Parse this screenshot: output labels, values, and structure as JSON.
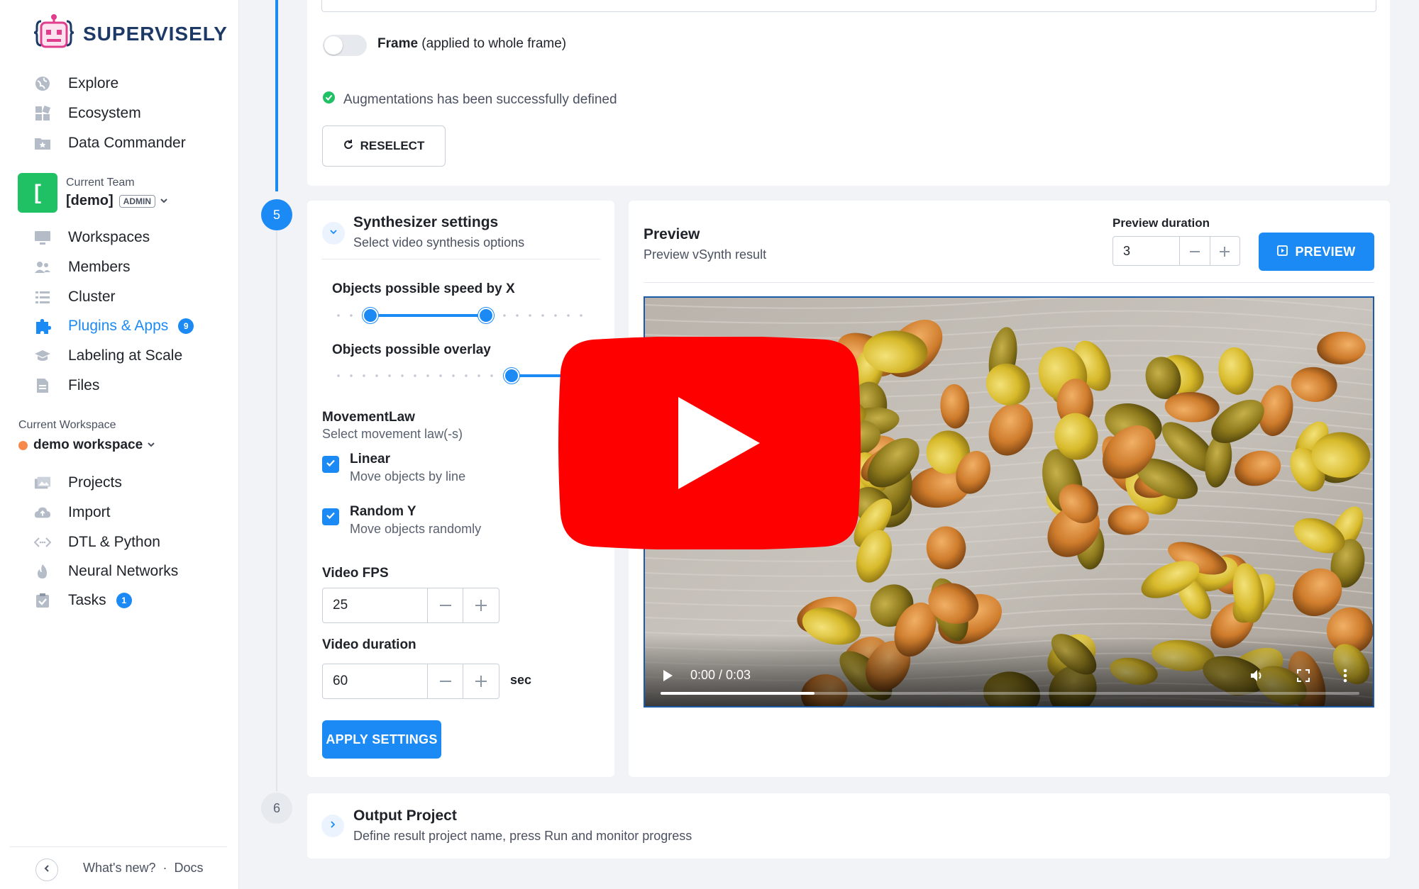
{
  "brand": {
    "name": "SUPERVISELY"
  },
  "sidebar": {
    "top_items": [
      {
        "label": "Explore",
        "icon": "globe-icon"
      },
      {
        "label": "Ecosystem",
        "icon": "grid-icon"
      },
      {
        "label": "Data Commander",
        "icon": "star-folder-icon"
      }
    ],
    "team": {
      "caption": "Current Team",
      "initial": "[",
      "name": "[demo]",
      "role": "ADMIN"
    },
    "team_items": [
      {
        "label": "Workspaces",
        "icon": "monitor-icon"
      },
      {
        "label": "Members",
        "icon": "users-icon"
      },
      {
        "label": "Cluster",
        "icon": "list-icon"
      },
      {
        "label": "Plugins & Apps",
        "icon": "puzzle-icon",
        "badge": "9"
      },
      {
        "label": "Labeling at Scale",
        "icon": "graduation-cap-icon"
      },
      {
        "label": "Files",
        "icon": "file-icon"
      }
    ],
    "workspace": {
      "caption": "Current Workspace",
      "name": "demo workspace"
    },
    "workspace_items": [
      {
        "label": "Projects",
        "icon": "images-icon"
      },
      {
        "label": "Import",
        "icon": "cloud-upload-icon"
      },
      {
        "label": "DTL & Python",
        "icon": "code-icon"
      },
      {
        "label": "Neural Networks",
        "icon": "flame-icon"
      },
      {
        "label": "Tasks",
        "icon": "clipboard-check-icon",
        "badge": "1"
      }
    ],
    "footer": {
      "whats_new": "What's new?",
      "separator": "·",
      "docs": "Docs"
    }
  },
  "augment_card": {
    "frame_toggle_bold": "Frame",
    "frame_toggle_rest": " (applied to whole frame)",
    "success_text": "Augmentations has been successfully defined",
    "reselect_label": "RESELECT"
  },
  "steps": {
    "step5": "5",
    "step6": "6"
  },
  "synth": {
    "title": "Synthesizer settings",
    "subtitle": "Select video synthesis options",
    "speed_label": "Objects possible speed by X",
    "speed_range": [
      0.15,
      0.6
    ],
    "overlay_label": "Objects possible overlay",
    "overlay_value": 0.7,
    "movement_title": "MovementLaw",
    "movement_subtitle": "Select movement law(-s)",
    "laws": [
      {
        "label": "Linear",
        "desc": "Move objects by line",
        "checked": true
      },
      {
        "label": "Random Y",
        "desc": "Move objects randomly",
        "checked": true
      }
    ],
    "fps_label": "Video FPS",
    "fps_value": "25",
    "duration_label": "Video duration",
    "duration_value": "60",
    "duration_unit": "sec",
    "apply_label": "APPLY SETTINGS"
  },
  "preview": {
    "title": "Preview",
    "subtitle": "Preview vSynth result",
    "duration_label": "Preview duration",
    "duration_value": "3",
    "button_label": "PREVIEW",
    "player_time": "0:00 / 0:03",
    "progress": 0.22
  },
  "output": {
    "title": "Output Project",
    "subtitle": "Define result project name, press Run and monitor progress"
  },
  "colors": {
    "accent": "#1c8af5",
    "success": "#20c065",
    "youtube": "#ff0000"
  }
}
